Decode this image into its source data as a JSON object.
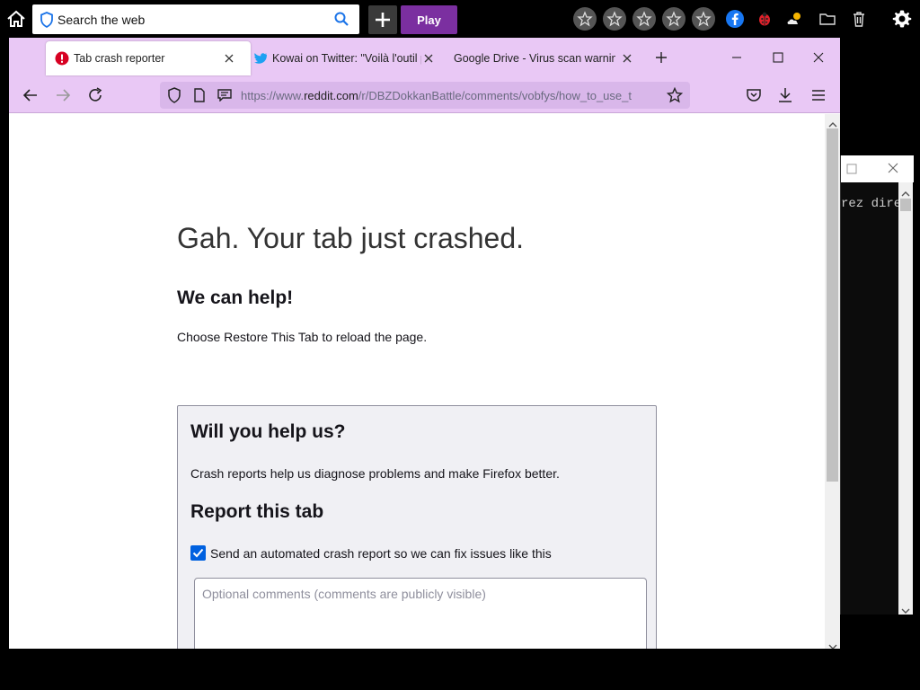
{
  "desktop": {
    "search_placeholder": "Search the web",
    "play_label": "Play",
    "tray_icons": [
      "star-icon",
      "star-icon",
      "star-icon",
      "star-icon",
      "star-icon",
      "facebook-icon",
      "ladybug-icon",
      "weather-icon",
      "folder-icon",
      "trash-icon",
      "gear-icon"
    ]
  },
  "browser": {
    "tabs": [
      {
        "label": "Tab crash reporter",
        "icon": "error-icon",
        "active": true
      },
      {
        "label": "Kowai on Twitter: \"Voilà l'outil p",
        "icon": "twitter-icon",
        "active": false
      },
      {
        "label": "Google Drive - Virus scan warning",
        "icon": "",
        "active": false
      }
    ],
    "url": {
      "prefix": "https://www.",
      "domain": "reddit.com",
      "path": "/r/DBZDokkanBattle/comments/vobfys/how_to_use_t"
    }
  },
  "page": {
    "title": "Gah. Your tab just crashed.",
    "help_heading": "We can help!",
    "help_text": "Choose Restore This Tab to reload the page.",
    "box_heading": "Will you help us?",
    "box_text": "Crash reports help us diagnose problems and make Firefox better.",
    "report_heading": "Report this tab",
    "checkbox_label": "Send an automated crash report so we can fix issues like this",
    "checkbox_checked": true,
    "comments_placeholder": "Optional comments (comments are publicly visible)"
  },
  "terminal": {
    "text": "rez dire"
  },
  "colors": {
    "accent_purple": "#7b2fa0",
    "tab_strip": "#e9c8f5",
    "checkbox_blue": "#0061e0"
  }
}
